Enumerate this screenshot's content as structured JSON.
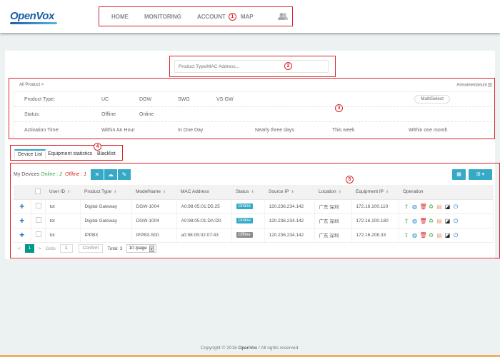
{
  "header": {
    "logo": "OpenVox",
    "nav": [
      {
        "label": "HOME"
      },
      {
        "label": "MONITORING"
      },
      {
        "label": "ACCOUNT"
      },
      {
        "label": "MAP"
      }
    ],
    "annotation": "1",
    "user_icon": "users-icon"
  },
  "search": {
    "placeholder": "Product Type/MAC Address...",
    "annotation": "2"
  },
  "filter": {
    "breadcrumb": "All Product >",
    "armamentarium": "Armamentarium",
    "annotation": "3",
    "rows": [
      {
        "label": "Product Type:",
        "options": [
          "UC",
          "DGW",
          "SWG",
          "VS-GW"
        ],
        "multiselect": "MultiSelect"
      },
      {
        "label": "Status:",
        "options": [
          "Offline",
          "Online"
        ]
      },
      {
        "label": "Activation Time:",
        "options": [
          "Within An Hour",
          "In One Day",
          "Nearly three days",
          "This week",
          "Within one month"
        ]
      }
    ]
  },
  "tabs": {
    "items": [
      {
        "label": "Device List",
        "active": true
      },
      {
        "label": "Equipment statistics"
      },
      {
        "label": "Blacklist"
      }
    ],
    "annotation": "4"
  },
  "devices": {
    "title": "My Devices",
    "online_label": "Online : 2",
    "offline_label": "Offline : 1",
    "toolbar": [
      "close-icon",
      "cloud-upload-icon",
      "edit-icon"
    ],
    "annotation": "5",
    "columns": [
      "",
      "",
      "User ID",
      "Product Type",
      "ModelName",
      "MAC Address",
      "Status",
      "Source IP",
      "Location",
      "Equipment IP",
      "Operation"
    ],
    "rows": [
      {
        "user_id": "tot",
        "product_type": "Digital Gateway",
        "model": "DGW-1004",
        "mac": "A0:98:05:01:D5:25",
        "status": "Online",
        "source_ip": "120.236.234.142",
        "location": "广东 深圳",
        "equipment_ip": "172.16.100.110"
      },
      {
        "user_id": "tot",
        "product_type": "Digital Gateway",
        "model": "DGW-1004",
        "mac": "A0:98:05:01:DA:D0",
        "status": "Online",
        "source_ip": "120.236.234.142",
        "location": "广东 深圳",
        "equipment_ip": "172.16.100.180"
      },
      {
        "user_id": "tot",
        "product_type": "IPPBX",
        "model": "IPPBX-500",
        "mac": "a0:98:05:02:07:43",
        "status": "Offline",
        "source_ip": "120.236.234.142",
        "location": "广东 深圳",
        "equipment_ip": "172.16.208.33"
      }
    ],
    "operations": [
      "upgrade-icon",
      "web-icon",
      "delete-icon",
      "share-icon",
      "config-icon",
      "terminal-icon",
      "power-icon"
    ],
    "colors": {
      "online": "#36a9c7",
      "offline": "#8c8c8c",
      "accent": "#36a9c7"
    }
  },
  "pager": {
    "prev": "<",
    "current": "1",
    "next": ">",
    "goto_label": "Goto",
    "goto_value": "1",
    "confirm": "Confirm",
    "total": "Total: 3",
    "per_page": "10 /page"
  },
  "footer": {
    "prefix": "Copyright © 2018 ",
    "brand": "OpenVox",
    "suffix": " / All rights reserved."
  }
}
